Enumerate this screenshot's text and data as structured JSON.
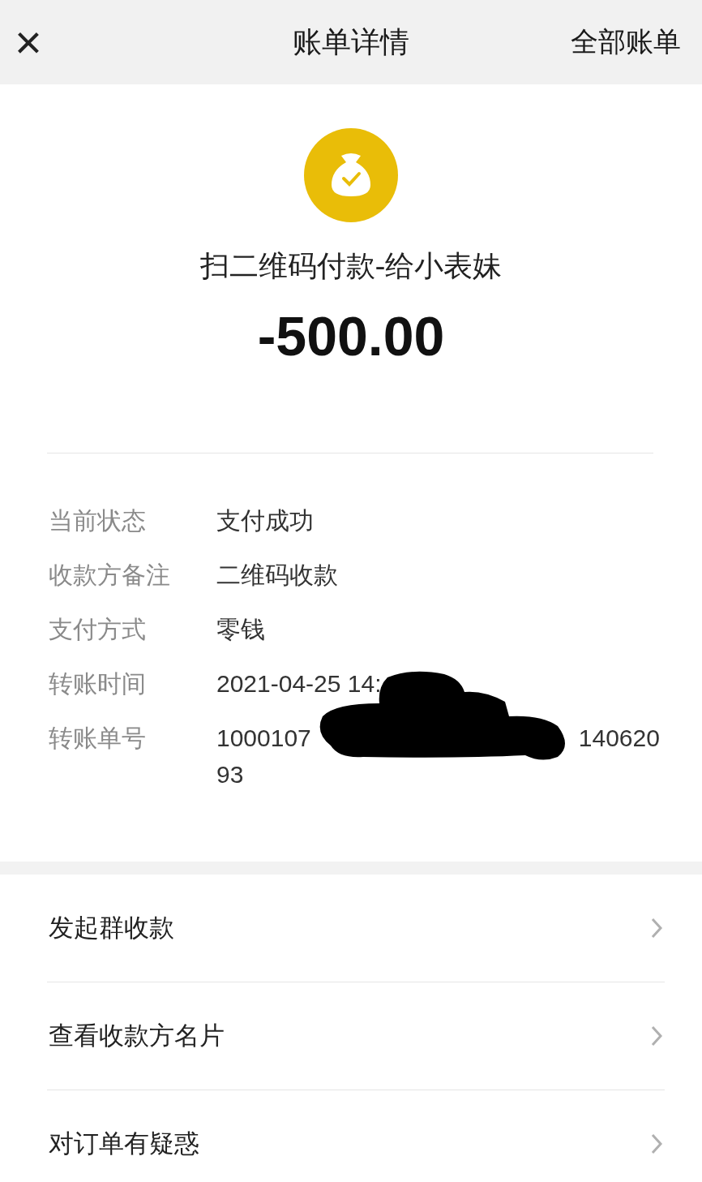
{
  "header": {
    "close": "×",
    "title": "账单详情",
    "action": "全部账单"
  },
  "summary": {
    "title": "扫二维码付款-给小表妹",
    "amount": "-500.00"
  },
  "details": [
    {
      "label": "当前状态",
      "value": "支付成功"
    },
    {
      "label": "收款方备注",
      "value": "二维码收款"
    },
    {
      "label": "支付方式",
      "value": "零钱"
    },
    {
      "label": "转账时间",
      "value": "2021-04-25 14:"
    },
    {
      "label": "转账单号",
      "value": "1000107",
      "value_tail": "140620",
      "value_line2": "93"
    }
  ],
  "actions": [
    {
      "label": "发起群收款"
    },
    {
      "label": "查看收款方名片"
    },
    {
      "label": "对订单有疑惑"
    }
  ]
}
